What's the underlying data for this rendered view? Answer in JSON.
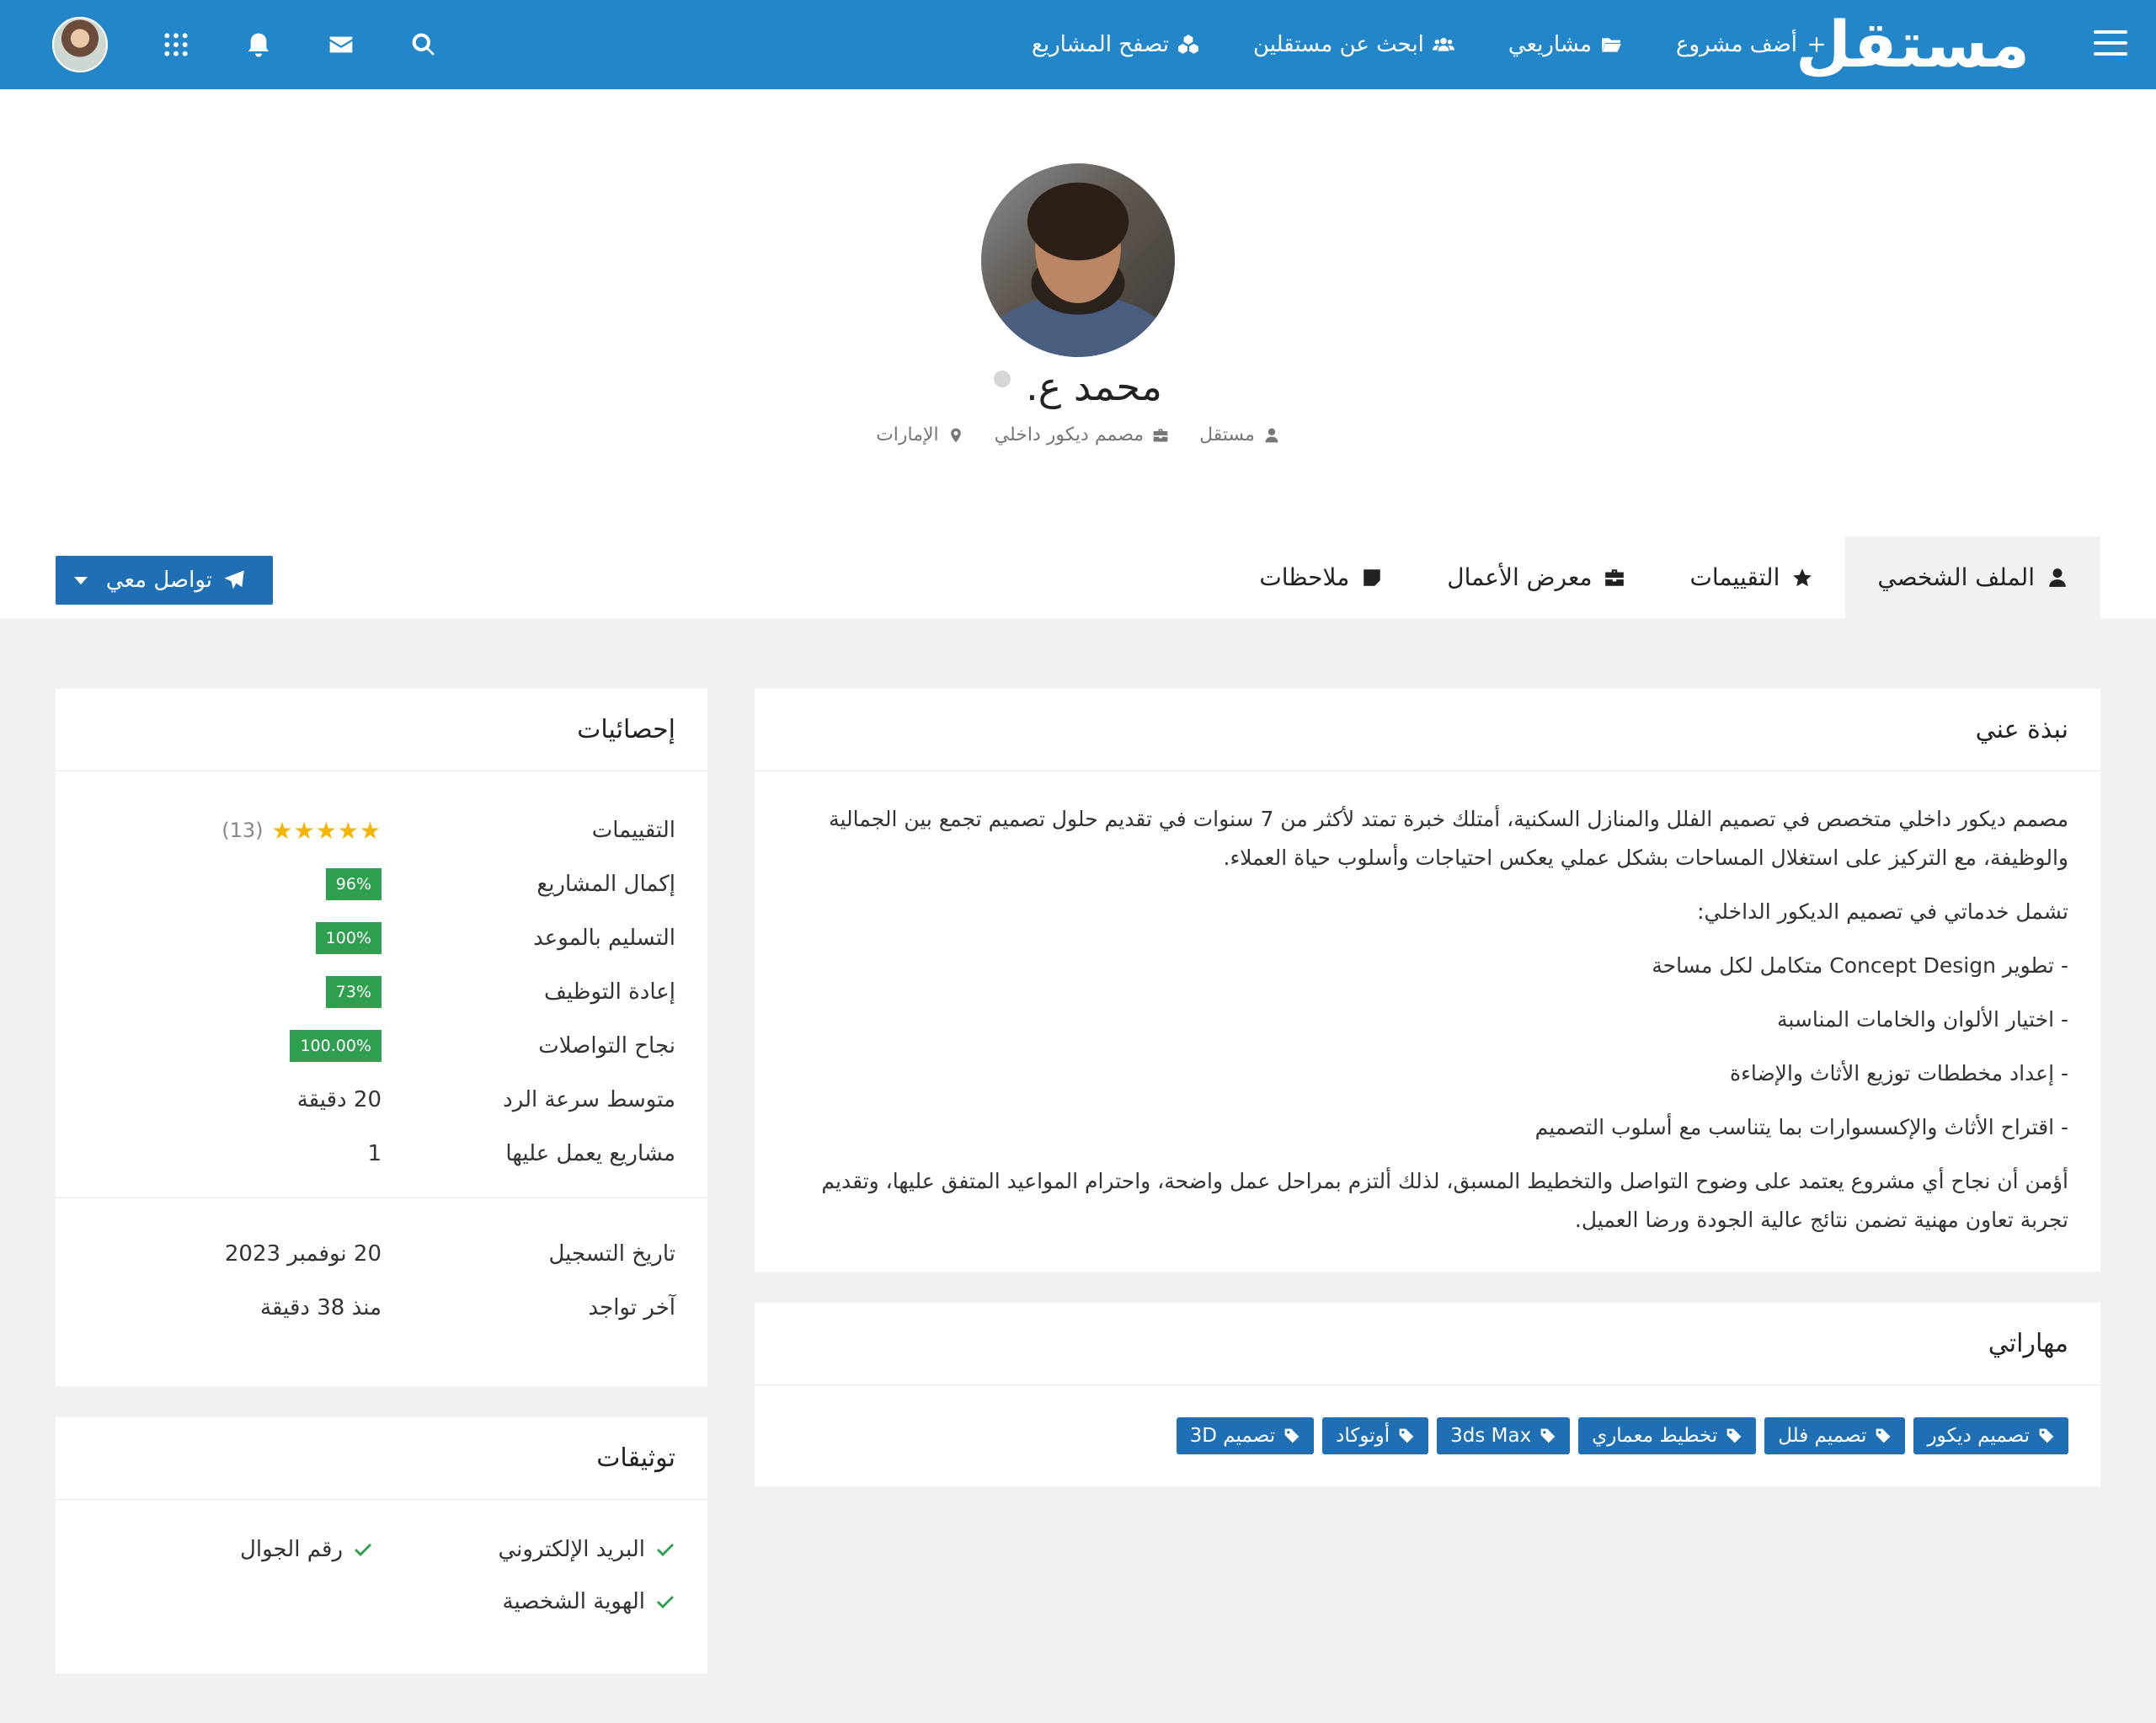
{
  "header": {
    "logo": "مستقل",
    "nav": [
      {
        "label": "أضف مشروع",
        "icon": "plus-icon"
      },
      {
        "label": "مشاريعي",
        "icon": "folder-icon"
      },
      {
        "label": "ابحث عن مستقلين",
        "icon": "users-icon"
      },
      {
        "label": "تصفح المشاريع",
        "icon": "cubes-icon"
      }
    ],
    "icons": [
      "avatar",
      "apps-grid-icon",
      "bell-icon",
      "envelope-icon",
      "search-icon"
    ]
  },
  "profile": {
    "name": "محمد ع.",
    "meta": [
      {
        "label": "مستقل",
        "icon": "user-icon"
      },
      {
        "label": "مصمم ديكور داخلي",
        "icon": "briefcase-icon"
      },
      {
        "label": "الإمارات",
        "icon": "map-marker-icon"
      }
    ]
  },
  "tabs": [
    {
      "label": "الملف الشخصي",
      "icon": "user-icon",
      "active": true
    },
    {
      "label": "التقييمات",
      "icon": "star-icon",
      "active": false
    },
    {
      "label": "معرض الأعمال",
      "icon": "briefcase-icon",
      "active": false
    },
    {
      "label": "ملاحظات",
      "icon": "note-icon",
      "active": false
    }
  ],
  "contact_button": "تواصل معي",
  "about": {
    "title": "نبذة عني",
    "paragraphs": [
      "مصمم ديكور داخلي متخصص في تصميم الفلل والمنازل السكنية، أمتلك خبرة تمتد لأكثر من 7 سنوات في تقديم حلول تصميم تجمع بين الجمالية والوظيفة، مع التركيز على استغلال المساحات بشكل عملي يعكس احتياجات وأسلوب حياة العملاء.",
      "تشمل خدماتي في تصميم الديكور الداخلي:",
      "- تطوير Concept Design متكامل لكل مساحة",
      "- اختيار الألوان والخامات المناسبة",
      "- إعداد مخططات توزيع الأثاث والإضاءة",
      "- اقتراح الأثاث والإكسسوارات بما يتناسب مع أسلوب التصميم",
      "أؤمن أن نجاح أي مشروع يعتمد على وضوح التواصل والتخطيط المسبق، لذلك ألتزم بمراحل عمل واضحة، واحترام المواعيد المتفق عليها، وتقديم تجربة تعاون مهنية تضمن نتائج عالية الجودة ورضا العميل."
    ]
  },
  "skills": {
    "title": "مهاراتي",
    "tags": [
      "تصميم ديكور",
      "تصميم فلل",
      "تخطيط معماري",
      "3ds Max",
      "أوتوكاد",
      "تصميم 3D"
    ]
  },
  "stats": {
    "title": "إحصائيات",
    "rating_label": "التقييمات",
    "rating_count": "(13)",
    "rating_stars": 5,
    "rows": [
      {
        "label": "إكمال المشاريع",
        "value": "96%",
        "badge": true
      },
      {
        "label": "التسليم بالموعد",
        "value": "100%",
        "badge": true
      },
      {
        "label": "إعادة التوظيف",
        "value": "73%",
        "badge": true
      },
      {
        "label": "نجاح التواصلات",
        "value": "100.00%",
        "badge": true
      },
      {
        "label": "متوسط سرعة الرد",
        "value": "20 دقيقة",
        "badge": false
      },
      {
        "label": "مشاريع يعمل عليها",
        "value": "1",
        "badge": false
      }
    ],
    "rows2": [
      {
        "label": "تاريخ التسجيل",
        "value": "20 نوفمبر 2023"
      },
      {
        "label": "آخر تواجد",
        "value": "منذ 38 دقيقة"
      }
    ]
  },
  "verify": {
    "title": "توثيقات",
    "items": [
      "البريد الإلكتروني",
      "رقم الجوال",
      "الهوية الشخصية"
    ]
  },
  "colors": {
    "header": "#2386c8",
    "accent": "#1f6fb4",
    "success": "#2e9e4f",
    "star": "#f5b400"
  }
}
